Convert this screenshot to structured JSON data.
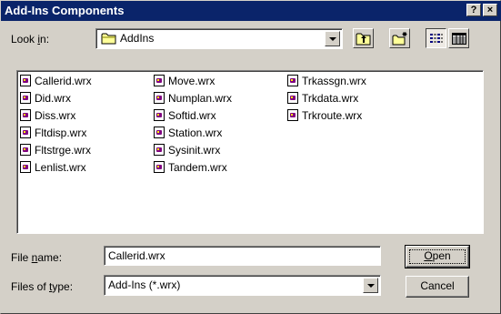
{
  "window": {
    "title": "Add-Ins Components",
    "help_label": "?",
    "close_label": "×"
  },
  "look_in": {
    "label_pre": "Look ",
    "label_key": "i",
    "label_post": "n:",
    "value": "AddIns"
  },
  "files": [
    {
      "name": "Callerid.wrx"
    },
    {
      "name": "Did.wrx"
    },
    {
      "name": "Diss.wrx"
    },
    {
      "name": "Fltdisp.wrx"
    },
    {
      "name": "Fltstrge.wrx"
    },
    {
      "name": "Lenlist.wrx"
    },
    {
      "name": "Move.wrx"
    },
    {
      "name": "Numplan.wrx"
    },
    {
      "name": "Softid.wrx"
    },
    {
      "name": "Station.wrx"
    },
    {
      "name": "Sysinit.wrx"
    },
    {
      "name": "Tandem.wrx"
    },
    {
      "name": "Trkassgn.wrx"
    },
    {
      "name": "Trkdata.wrx"
    },
    {
      "name": "Trkroute.wrx"
    }
  ],
  "file_name": {
    "label_pre": "File ",
    "label_key": "n",
    "label_post": "ame:",
    "value": "Callerid.wrx"
  },
  "file_type": {
    "label_pre": "Files of ",
    "label_key": "t",
    "label_post": "ype:",
    "value": "Add-Ins (*.wrx)"
  },
  "buttons": {
    "open_key": "O",
    "open_rest": "pen",
    "cancel": "Cancel"
  },
  "colors": {
    "title_bar": "#0a246a",
    "face": "#d4d0c8"
  }
}
